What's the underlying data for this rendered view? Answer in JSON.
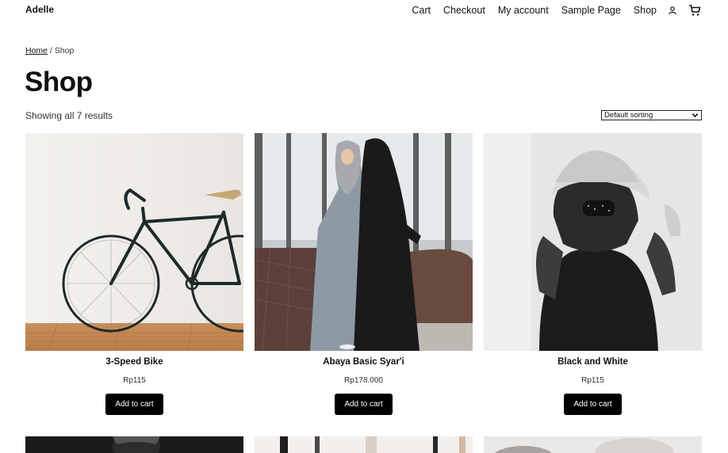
{
  "header": {
    "site_title": "Adelle",
    "nav": [
      "Cart",
      "Checkout",
      "My account",
      "Sample Page",
      "Shop"
    ],
    "icons": [
      "account-icon",
      "cart-icon"
    ]
  },
  "breadcrumb": {
    "home": "Home",
    "separator": " / ",
    "current": "Shop"
  },
  "page": {
    "title": "Shop",
    "result_count": "Showing all 7 results",
    "sorting_selected": "Default sorting"
  },
  "products": [
    {
      "name": "3-Speed Bike",
      "price": "Rp115",
      "button": "Add to cart"
    },
    {
      "name": "Abaya Basic Syar'i",
      "price": "Rp178.000",
      "button": "Add to cart"
    },
    {
      "name": "Black and White",
      "price": "Rp115",
      "button": "Add to cart"
    }
  ]
}
